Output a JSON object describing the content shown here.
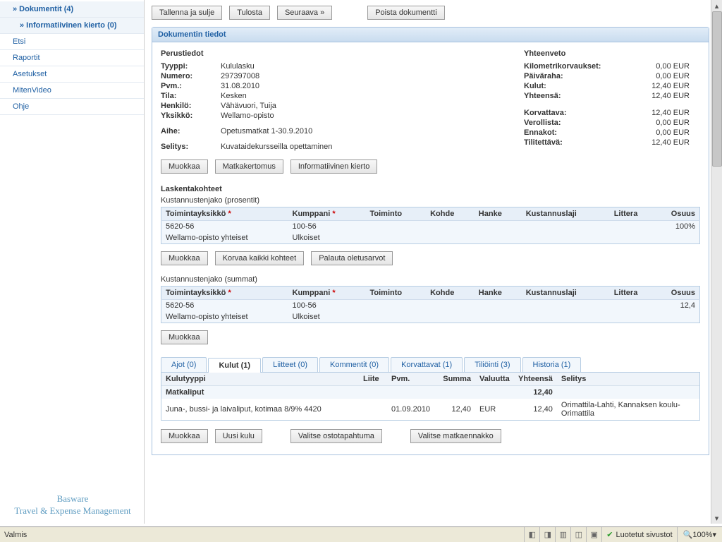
{
  "sidebar": {
    "items": [
      {
        "label": "» Dokumentit (4)",
        "level": 1,
        "active": true
      },
      {
        "label": "» Informatiivinen kierto (0)",
        "level": 2,
        "active": true
      },
      {
        "label": "Etsi",
        "level": 1
      },
      {
        "label": "Raportit",
        "level": 1
      },
      {
        "label": "Asetukset",
        "level": 1
      },
      {
        "label": "MitenVideo",
        "level": 1
      },
      {
        "label": "Ohje",
        "level": 1
      }
    ],
    "brand1": "Basware",
    "brand2": "Travel & Expense Management"
  },
  "toolbar": {
    "save_close": "Tallenna ja sulje",
    "print": "Tulosta",
    "next": "Seuraava »",
    "delete": "Poista dokumentti"
  },
  "panel": {
    "title": "Dokumentin tiedot"
  },
  "basic": {
    "title": "Perustiedot",
    "rows": {
      "type_l": "Tyyppi:",
      "type_v": "Kululasku",
      "num_l": "Numero:",
      "num_v": "297397008",
      "date_l": "Pvm.:",
      "date_v": "31.08.2010",
      "state_l": "Tila:",
      "state_v": "Kesken",
      "person_l": "Henkilö:",
      "person_v": "Vähävuori, Tuija",
      "unit_l": "Yksikkö:",
      "unit_v": "Wellamo-opisto",
      "subj_l": "Aihe:",
      "subj_v": "Opetusmatkat 1-30.9.2010",
      "desc_l": "Selitys:",
      "desc_v": "Kuvataidekursseilla opettaminen"
    }
  },
  "summary": {
    "title": "Yhteenveto",
    "rows": [
      {
        "l": "Kilometrikorvaukset:",
        "v": "0,00 EUR"
      },
      {
        "l": "Päiväraha:",
        "v": "0,00 EUR"
      },
      {
        "l": "Kulut:",
        "v": "12,40 EUR"
      },
      {
        "l": "Yhteensä:",
        "v": "12,40 EUR"
      },
      {
        "l": "",
        "v": ""
      },
      {
        "l": "Korvattava:",
        "v": "12,40 EUR"
      },
      {
        "l": "Verollista:",
        "v": "0,00 EUR"
      },
      {
        "l": "Ennakot:",
        "v": "0,00 EUR"
      },
      {
        "l": "Tilitettävä:",
        "v": "12,40 EUR"
      }
    ]
  },
  "buttons": {
    "edit": "Muokkaa",
    "travel_report": "Matkakertomus",
    "info_cycle": "Informatiivinen kierto",
    "replace_all": "Korvaa kaikki kohteet",
    "restore_defaults": "Palauta oletusarvot",
    "new_expense": "Uusi kulu",
    "select_purchase": "Valitse ostotapahtuma",
    "select_advance": "Valitse matkaennakko"
  },
  "alloc": {
    "section": "Laskentakohteet",
    "pct_title": "Kustannustenjako (prosentit)",
    "sum_title": "Kustannustenjako (summat)",
    "cols": {
      "unit": "Toimintayksikkö",
      "partner": "Kumppani",
      "action": "Toiminto",
      "target": "Kohde",
      "project": "Hanke",
      "costtype": "Kustannuslaji",
      "littera": "Littera",
      "share": "Osuus"
    },
    "pct_rows": [
      [
        "5620-56",
        "100-56",
        "",
        "",
        "",
        "",
        "",
        "100%"
      ],
      [
        "Wellamo-opisto yhteiset",
        "Ulkoiset",
        "",
        "",
        "",
        "",
        "",
        ""
      ]
    ],
    "sum_rows": [
      [
        "5620-56",
        "100-56",
        "",
        "",
        "",
        "",
        "",
        "12,4"
      ],
      [
        "Wellamo-opisto yhteiset",
        "Ulkoiset",
        "",
        "",
        "",
        "",
        "",
        ""
      ]
    ]
  },
  "tabs": {
    "items": [
      {
        "label": "Ajot (0)"
      },
      {
        "label": "Kulut (1)",
        "active": true
      },
      {
        "label": "Liitteet (0)"
      },
      {
        "label": "Kommentit (0)"
      },
      {
        "label": "Korvattavat (1)"
      },
      {
        "label": "Tiliöinti (3)"
      },
      {
        "label": "Historia (1)"
      }
    ]
  },
  "expenses": {
    "cols": {
      "type": "Kulutyyppi",
      "att": "Liite",
      "date": "Pvm.",
      "sum": "Summa",
      "cur": "Valuutta",
      "total": "Yhteensä",
      "desc": "Selitys"
    },
    "group": {
      "label": "Matkaliput",
      "total": "12,40"
    },
    "row": {
      "type": "Juna-, bussi- ja laivaliput, kotimaa 8/9% 4420",
      "att": "",
      "date": "01.09.2010",
      "sum": "12,40",
      "cur": "EUR",
      "total": "12,40",
      "desc": "Orimattila-Lahti, Kannaksen koulu-Orimattila"
    }
  },
  "statusbar": {
    "ready": "Valmis",
    "trusted": "Luotetut sivustot",
    "zoom": "100%"
  }
}
